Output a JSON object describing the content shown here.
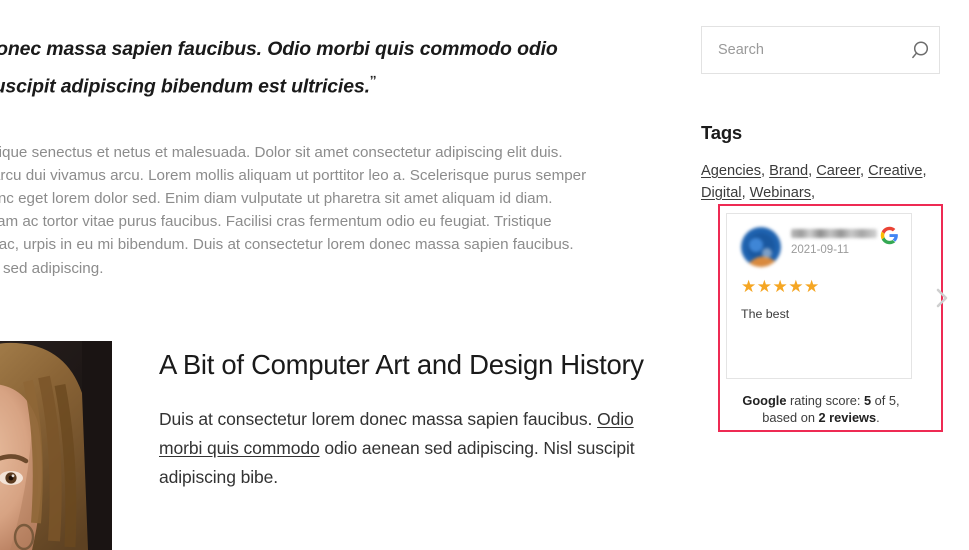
{
  "article": {
    "blockquote": {
      "line1": "orem donec massa sapien faucibus. Odio morbi quis commodo odio",
      "line2": ". Nisl suscipit adipiscing bibendum est ultricies.",
      "end_mark": "ˮ"
    },
    "paragraph_lines": [
      "morbi tristique senectus et netus et malesuada. Dolor sit amet consectetur adipiscing elit duis.",
      "s ornare arcu dui vivamus arcu. Lorem mollis aliquam ut porttitor leo a. Scelerisque purus semper",
      "l turpis nunc eget lorem dolor sed. Enim diam vulputate ut pharetra sit amet aliquam id diam.",
      "otenti nullam ac tortor vitae purus faucibus. Facilisi cras fermentum odio eu feugiat. Tristique",
      "da fames ac, urpis in eu mi bibendum. Duis at consectetur lorem donec massa sapien faucibus.",
      "io aenean sed adipiscing."
    ],
    "post": {
      "title": "A Bit of Computer Art and Design History",
      "excerpt_part1": "Duis at consectetur lorem donec massa sapien faucibus. ",
      "excerpt_link": "Odio morbi quis commodo",
      "excerpt_part2": " odio aenean sed adipiscing. Nisl suscipit adipiscing bibe.",
      "image_alt": "portrait-photo"
    }
  },
  "sidebar": {
    "search": {
      "placeholder": "Search",
      "value": "",
      "icon": "search-icon"
    },
    "tags": {
      "title": "Tags",
      "items": [
        "Agencies",
        "Brand",
        "Career",
        "Creative",
        "Digital",
        "Webinars"
      ],
      "separator": ", ",
      "trailing_separator": ","
    },
    "reviews": {
      "highlight_color": "#ee2a53",
      "star_color": "#f5a623",
      "review": {
        "author_name_blurred": true,
        "date": "2021-09-11",
        "stars": "★★★★★",
        "rating_value": 5,
        "text": "The best",
        "provider_logo": "google-g-logo",
        "avatar": "reviewer-avatar"
      },
      "next_label": "›",
      "score": {
        "brand": "Google",
        "mid1": " rating score: ",
        "value": "5",
        "mid2": " of 5,",
        "line2_prefix": "based on ",
        "count": "2 reviews",
        "suffix": "."
      }
    }
  }
}
